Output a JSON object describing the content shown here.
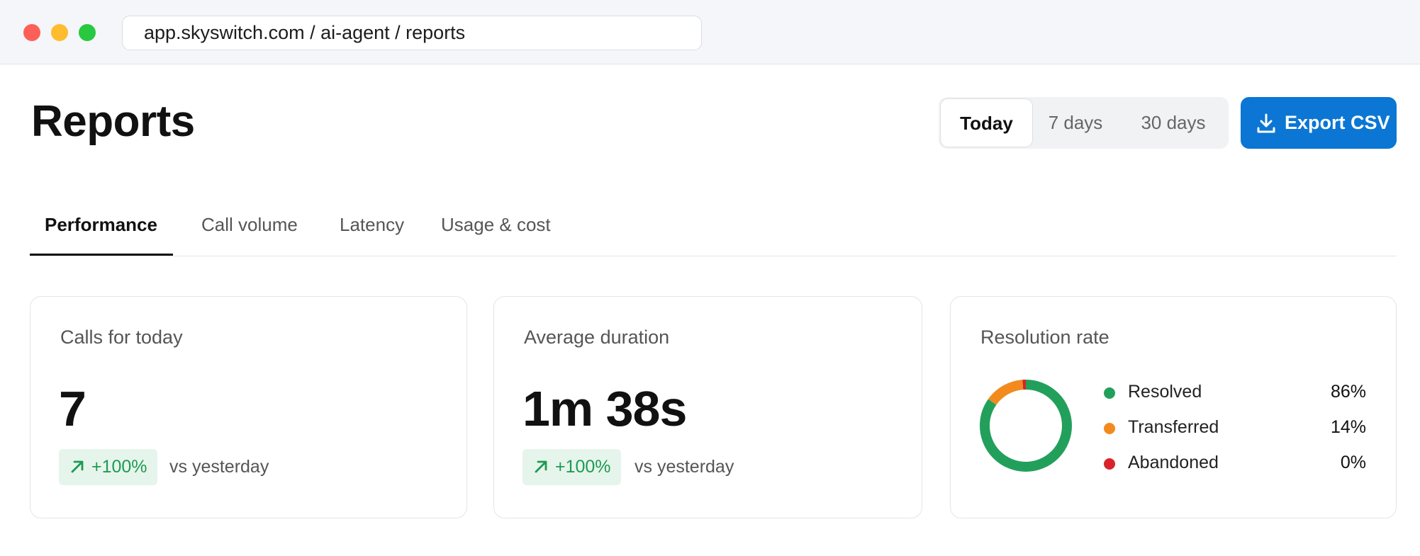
{
  "browser": {
    "url": "app.skyswitch.com / ai-agent / reports"
  },
  "header": {
    "title": "Reports",
    "ranges": [
      "Today",
      "7 days",
      "30 days"
    ],
    "selected_range": "Today",
    "export_label": "Export CSV"
  },
  "tabs": [
    {
      "label": "Performance",
      "active": true
    },
    {
      "label": "Call volume",
      "active": false
    },
    {
      "label": "Latency",
      "active": false
    },
    {
      "label": "Usage & cost",
      "active": false
    }
  ],
  "cards": {
    "calls": {
      "title": "Calls for today",
      "value": "7",
      "delta": "+100%",
      "comparison": "vs yesterday"
    },
    "duration": {
      "title": "Average duration",
      "value": "1m 38s",
      "delta": "+100%",
      "comparison": "vs yesterday"
    },
    "resolution": {
      "title": "Resolution rate",
      "items": [
        {
          "label": "Resolved",
          "pct": "86%",
          "value": 86,
          "color": "#22a05b"
        },
        {
          "label": "Transferred",
          "pct": "14%",
          "value": 14,
          "color": "#f28a1e"
        },
        {
          "label": "Abandoned",
          "pct": "0%",
          "value": 0,
          "color": "#d8232a"
        }
      ]
    }
  },
  "colors": {
    "accent": "#0b76d4",
    "positive": "#1f9a52",
    "positive_bg": "#e6f5ec"
  },
  "icons": {
    "export": "download-icon",
    "delta": "arrow-up-right-icon"
  }
}
